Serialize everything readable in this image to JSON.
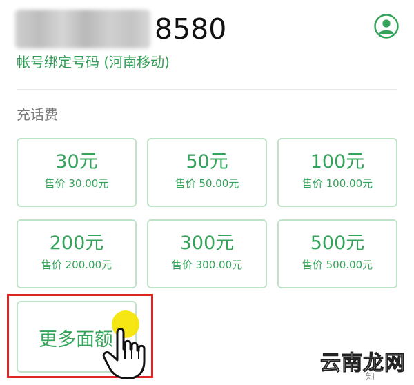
{
  "header": {
    "phone_suffix": "8580",
    "bind_label": "帐号绑定号码 (河南移动)"
  },
  "section": {
    "title": "充话费"
  },
  "options": [
    {
      "amount": "30元",
      "price": "售价 30.00元"
    },
    {
      "amount": "50元",
      "price": "售价 50.00元"
    },
    {
      "amount": "100元",
      "price": "售价 100.00元"
    },
    {
      "amount": "200元",
      "price": "售价 200.00元"
    },
    {
      "amount": "300元",
      "price": "售价 300.00元"
    },
    {
      "amount": "500元",
      "price": "售价 500.00元"
    }
  ],
  "more": {
    "label": "更多面额"
  },
  "watermark": {
    "brand": "云南龙网",
    "sub": "知"
  },
  "colors": {
    "accent": "#33a35a",
    "tile_border": "#bfe2c9",
    "highlight": "#e12626",
    "cursor_dot": "#f5e400"
  },
  "icons": {
    "avatar": "user-avatar-icon",
    "cursor": "hand-pointer-icon"
  }
}
